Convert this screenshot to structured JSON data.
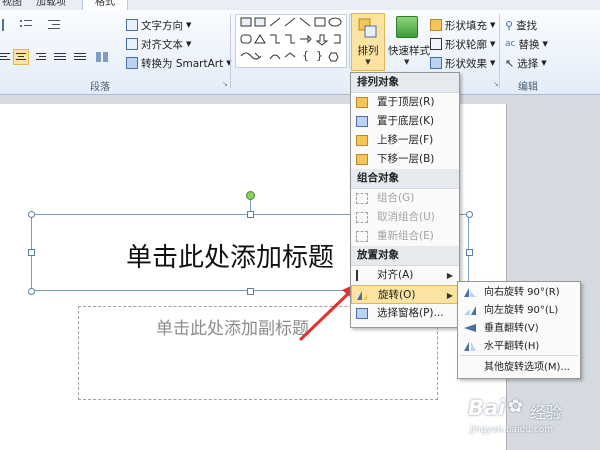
{
  "tabs": {
    "view": "视图",
    "addins": "加载项",
    "format": "格式"
  },
  "paragraph": {
    "text_direction": "文字方向",
    "align_text": "对齐文本",
    "convert_smartart": "转换为 SmartArt",
    "group_label": "段落"
  },
  "arrange": {
    "arrange_label": "排列",
    "quick_styles_label": "快速样式",
    "shape_fill": "形状填充",
    "shape_outline": "形状轮廓",
    "shape_effects": "形状效果"
  },
  "editing": {
    "find": "查找",
    "replace": "替换",
    "select": "选择",
    "group_label": "编辑"
  },
  "slide": {
    "title_placeholder": "单击此处添加标题",
    "subtitle_placeholder": "单击此处添加副标题"
  },
  "arrange_menu": {
    "section_order": "排列对象",
    "bring_front": "置于顶层(R)",
    "send_back": "置于底层(K)",
    "bring_forward": "上移一层(F)",
    "send_backward": "下移一层(B)",
    "section_group": "组合对象",
    "group": "组合(G)",
    "ungroup": "取消组合(U)",
    "regroup": "重新组合(E)",
    "section_position": "放置对象",
    "align": "对齐(A)",
    "rotate": "旋转(O)",
    "selection_pane": "选择窗格(P)..."
  },
  "rotate_menu": {
    "rotate_right": "向右旋转 90°(R)",
    "rotate_left": "向左旋转 90°(L)",
    "flip_vertical": "垂直翻转(V)",
    "flip_horizontal": "水平翻转(H)",
    "more_options": "其他旋转选项(M)..."
  },
  "watermark": {
    "brand": "Bai",
    "brand_suffix": "经验",
    "url": "jingyan.baidu.com"
  },
  "colors": {
    "accent": "#e2b65a",
    "highlight": "#fde3a1",
    "arrow": "#e0332e"
  }
}
